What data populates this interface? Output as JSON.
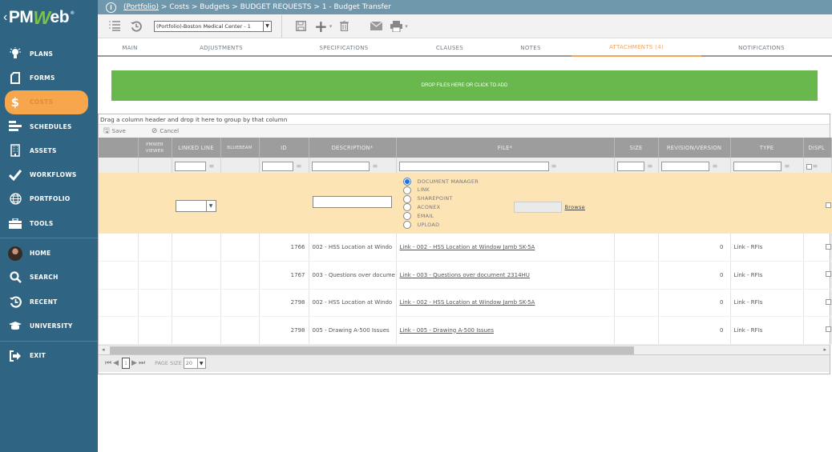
{
  "app": {
    "logo_prefix": "‹",
    "logo_pm": "PM",
    "logo_w": "W",
    "logo_eb": "eb",
    "logo_reg": "®"
  },
  "sidebar": {
    "items": [
      {
        "label": "PLANS",
        "icon": "lightbulb-icon"
      },
      {
        "label": "FORMS",
        "icon": "document-icon"
      },
      {
        "label": "COSTS",
        "icon": "dollar-icon",
        "active": true
      },
      {
        "label": "SCHEDULES",
        "icon": "gantt-bars-icon"
      },
      {
        "label": "ASSETS",
        "icon": "building-icon"
      },
      {
        "label": "WORKFLOWS",
        "icon": "checkmark-icon"
      },
      {
        "label": "PORTFOLIO",
        "icon": "globe-icon"
      },
      {
        "label": "TOOLS",
        "icon": "toolbox-icon"
      }
    ],
    "bottom_items": [
      {
        "label": "HOME",
        "icon": "avatar"
      },
      {
        "label": "SEARCH",
        "icon": "search-icon"
      },
      {
        "label": "RECENT",
        "icon": "history-icon"
      },
      {
        "label": "UNIVERSITY",
        "icon": "graduation-cap-icon"
      }
    ],
    "exit_label": "EXIT"
  },
  "breadcrumb": {
    "portfolio": "(Portfolio)",
    "rest": " > Costs > Budgets > BUDGET REQUESTS > 1 - Budget Transfer"
  },
  "toolbar": {
    "project_select": "(Portfolio)-Boston Medical Center - 1"
  },
  "tabs": [
    {
      "label": "MAIN"
    },
    {
      "label": "ADJUSTMENTS"
    },
    {
      "label": "SPECIFICATIONS"
    },
    {
      "label": "CLAUSES"
    },
    {
      "label": "NOTES"
    },
    {
      "label": "ATTACHMENTS (4)",
      "active": true
    },
    {
      "label": "NOTIFICATIONS"
    }
  ],
  "dropzone": {
    "label": "DROP FILES HERE OR CLICK TO ADD"
  },
  "grid": {
    "group_hint": "Drag a column header and drop it here to group by that column",
    "save_label": "Save",
    "cancel_label": "Cancel",
    "columns": [
      "",
      "PMWEB VIEWER",
      "LINKED LINE",
      "BLUEBEAM",
      "ID",
      "DESCRIPTION*",
      "FILE*",
      "SIZE",
      "REVISION/VERSION",
      "TYPE",
      "DISPL"
    ],
    "source_options": [
      "DOCUMENT MANAGER",
      "LINK",
      "SHAREPOINT",
      "ACONEX",
      "EMAIL",
      "UPLOAD"
    ],
    "source_selected": "DOCUMENT MANAGER",
    "browse_label": "Browse",
    "rows": [
      {
        "id": "1766",
        "description": "002 - HSS Location at Windo",
        "file": "Link - 002 - HSS Location at Window Jamb SK-5A",
        "size": "",
        "revision": "0",
        "type": "Link - RFIs"
      },
      {
        "id": "1767",
        "description": "003 - Questions over docume",
        "file": "Link - 003 - Questions over document 2314HU",
        "size": "",
        "revision": "0",
        "type": "Link - RFIs"
      },
      {
        "id": "2798",
        "description": "002 - HSS Location at Windo",
        "file": "Link - 002 - HSS Location at Window Jamb SK-5A",
        "size": "",
        "revision": "0",
        "type": "Link - RFIs"
      },
      {
        "id": "2798",
        "description": "005 - Drawing A-500 Issues",
        "file": "Link - 005 - Drawing A-500 Issues",
        "size": "",
        "revision": "0",
        "type": "Link - RFIs"
      }
    ],
    "pager": {
      "current_page": "1",
      "page_size_label": "PAGE SIZE",
      "page_size": "20"
    }
  }
}
